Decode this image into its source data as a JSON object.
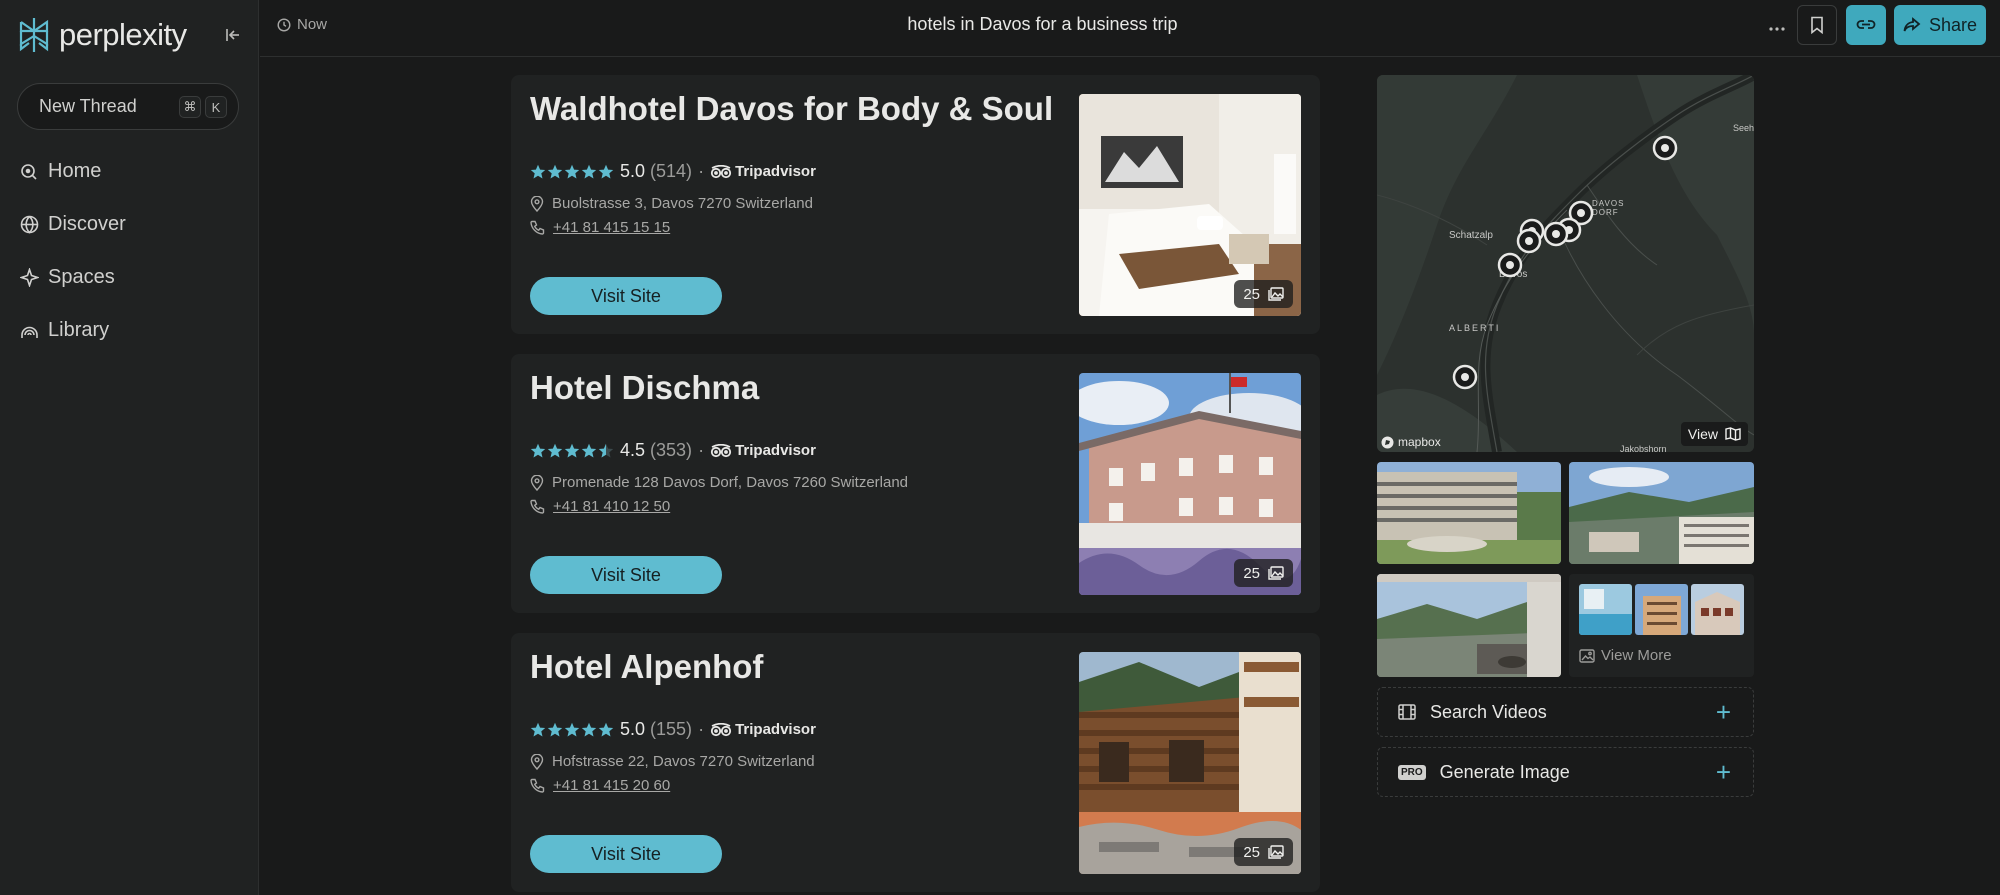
{
  "sidebar": {
    "logo_text": "perplexity",
    "new_thread": "New Thread",
    "shortcut": [
      "⌘",
      "K"
    ],
    "nav": [
      {
        "label": "Home",
        "icon": "home-icon"
      },
      {
        "label": "Discover",
        "icon": "globe-icon"
      },
      {
        "label": "Spaces",
        "icon": "spaces-icon"
      },
      {
        "label": "Library",
        "icon": "library-icon"
      }
    ]
  },
  "header": {
    "timestamp": "Now",
    "title": "hotels in Davos for a business trip",
    "share_label": "Share"
  },
  "hotels": [
    {
      "name": "Waldhotel Davos for Body & Soul",
      "rating": "5.0",
      "reviews": "(514)",
      "stars": 5,
      "source": "Tripadvisor",
      "address": "Buolstrasse 3, Davos 7270 Switzerland",
      "phone": "+41 81 415 15 15",
      "visit": "Visit Site",
      "photos": "25"
    },
    {
      "name": "Hotel Dischma",
      "rating": "4.5",
      "reviews": "(353)",
      "stars": 4.5,
      "source": "Tripadvisor",
      "address": "Promenade 128 Davos Dorf, Davos 7260 Switzerland",
      "phone": "+41 81 410 12 50",
      "visit": "Visit Site",
      "photos": "25"
    },
    {
      "name": "Hotel Alpenhof",
      "rating": "5.0",
      "reviews": "(155)",
      "stars": 5,
      "source": "Tripadvisor",
      "address": "Hofstrasse 22, Davos 7270 Switzerland",
      "phone": "+41 81 415 20 60",
      "visit": "Visit Site",
      "photos": "25"
    }
  ],
  "map": {
    "view_label": "View",
    "attribution": "mapbox",
    "labels": [
      "Schatzalp",
      "Davos",
      "ALBERTI",
      "Seehorn",
      "Jakobshorn",
      "DAVOS DORF"
    ]
  },
  "gallery": {
    "view_more": "View More"
  },
  "actions": {
    "search_videos": "Search Videos",
    "generate_image": "Generate Image",
    "pro_badge": "PRO"
  },
  "colors": {
    "accent": "#5fbcd0",
    "star": "#5fbcd0",
    "background": "#191a1a",
    "panel": "#202222"
  }
}
